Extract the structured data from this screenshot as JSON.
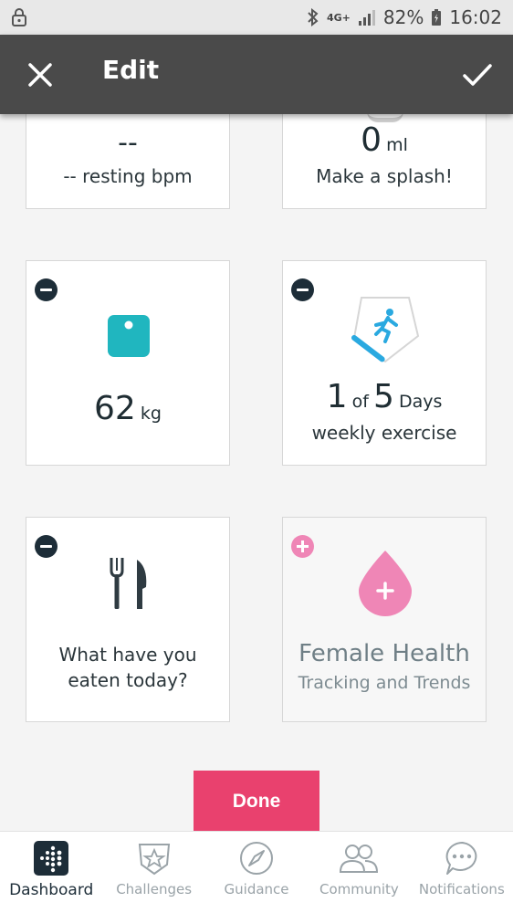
{
  "status_bar": {
    "battery": "82%",
    "time": "16:02",
    "network": "4G+"
  },
  "header": {
    "title": "Edit"
  },
  "tiles": {
    "heart": {
      "value": "--",
      "label": "-- resting bpm"
    },
    "water": {
      "value": "0",
      "unit": "ml",
      "label": "Make a splash!"
    },
    "weight": {
      "value": "62",
      "unit": "kg"
    },
    "exercise": {
      "done": "1",
      "of": "of",
      "goal": "5",
      "unit": "Days",
      "label": "weekly exercise",
      "progress": 0.2
    },
    "food": {
      "line1": "What have you",
      "line2": "eaten today?"
    },
    "female": {
      "title": "Female Health",
      "subtitle": "Tracking and Trends"
    }
  },
  "done_label": "Done",
  "nav": [
    {
      "label": "Dashboard",
      "icon": "dashboard-icon",
      "active": true
    },
    {
      "label": "Challenges",
      "icon": "challenges-icon"
    },
    {
      "label": "Guidance",
      "icon": "compass-icon"
    },
    {
      "label": "Community",
      "icon": "community-icon"
    },
    {
      "label": "Notifications",
      "icon": "notifications-icon"
    }
  ],
  "colors": {
    "accent": "#e9416e",
    "teal": "#20b6bf",
    "pink": "#ef86b6",
    "dark": "#1d2d38",
    "exercise_blue": "#2aa9e0"
  }
}
